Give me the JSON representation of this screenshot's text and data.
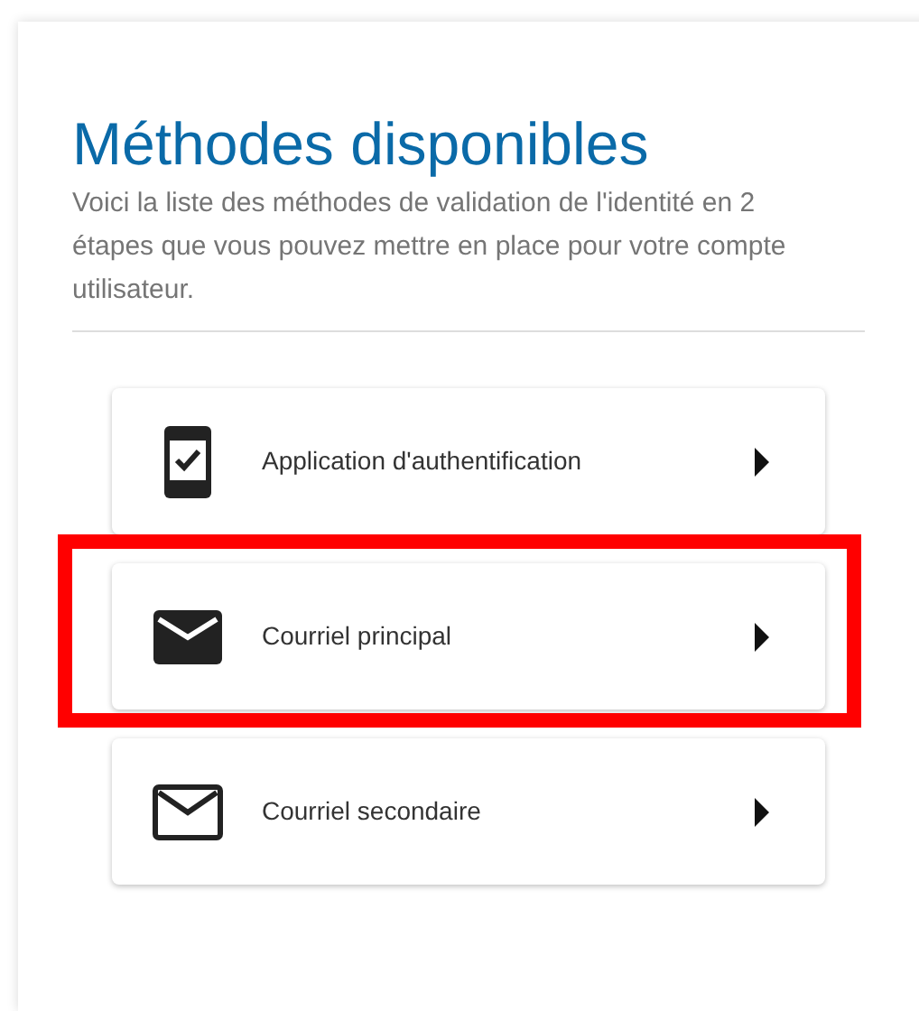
{
  "title": "Méthodes disponibles",
  "description": "Voici la liste des méthodes de validation de l'identité en 2 étapes que vous pouvez mettre en place pour votre compte utilisateur.",
  "methods": [
    {
      "kind": "app",
      "label": "Application d'authentification",
      "highlighted": false
    },
    {
      "kind": "email_filled",
      "label": "Courriel principal",
      "highlighted": true
    },
    {
      "kind": "email_outline",
      "label": "Courriel secondaire",
      "highlighted": false
    }
  ]
}
